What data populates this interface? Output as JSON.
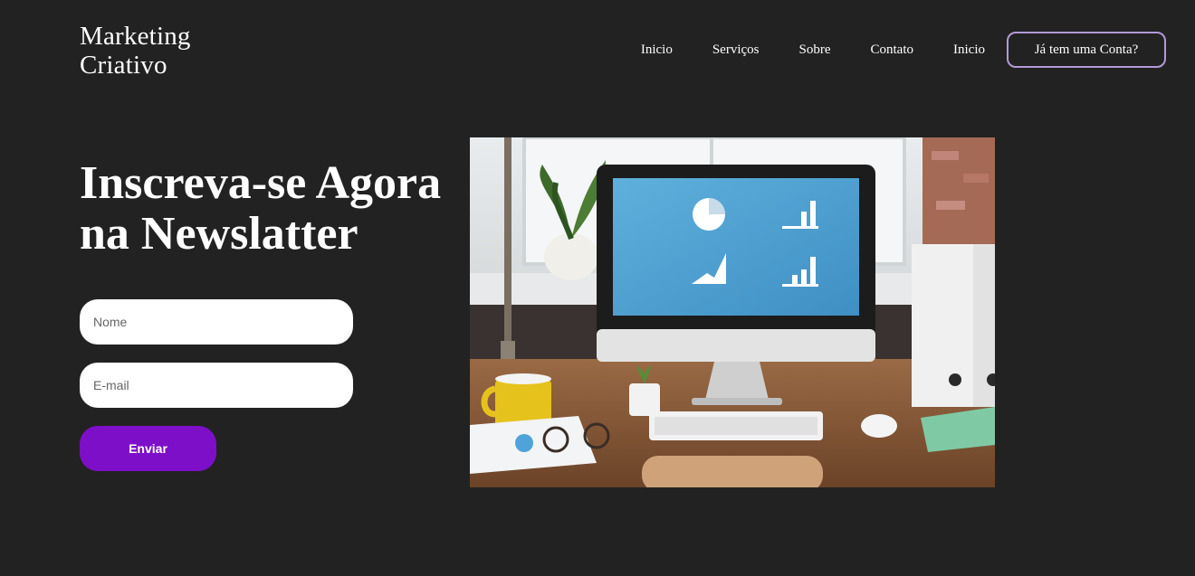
{
  "logo": {
    "line1": "Marketing",
    "line2": "Criativo"
  },
  "nav": {
    "items": [
      {
        "label": "Inicio"
      },
      {
        "label": "Serviços"
      },
      {
        "label": "Sobre"
      },
      {
        "label": "Contato"
      },
      {
        "label": "Inicio"
      }
    ],
    "account_button": "Já tem uma Conta?"
  },
  "hero": {
    "title_line1": "Inscreva-se Agora",
    "title_line2": "na Newslatter"
  },
  "form": {
    "name_placeholder": "Nome",
    "email_placeholder": "E-mail",
    "submit_label": "Enviar"
  },
  "colors": {
    "background": "#222222",
    "button": "#7e0fc9",
    "account_border": "#b39ad6"
  }
}
